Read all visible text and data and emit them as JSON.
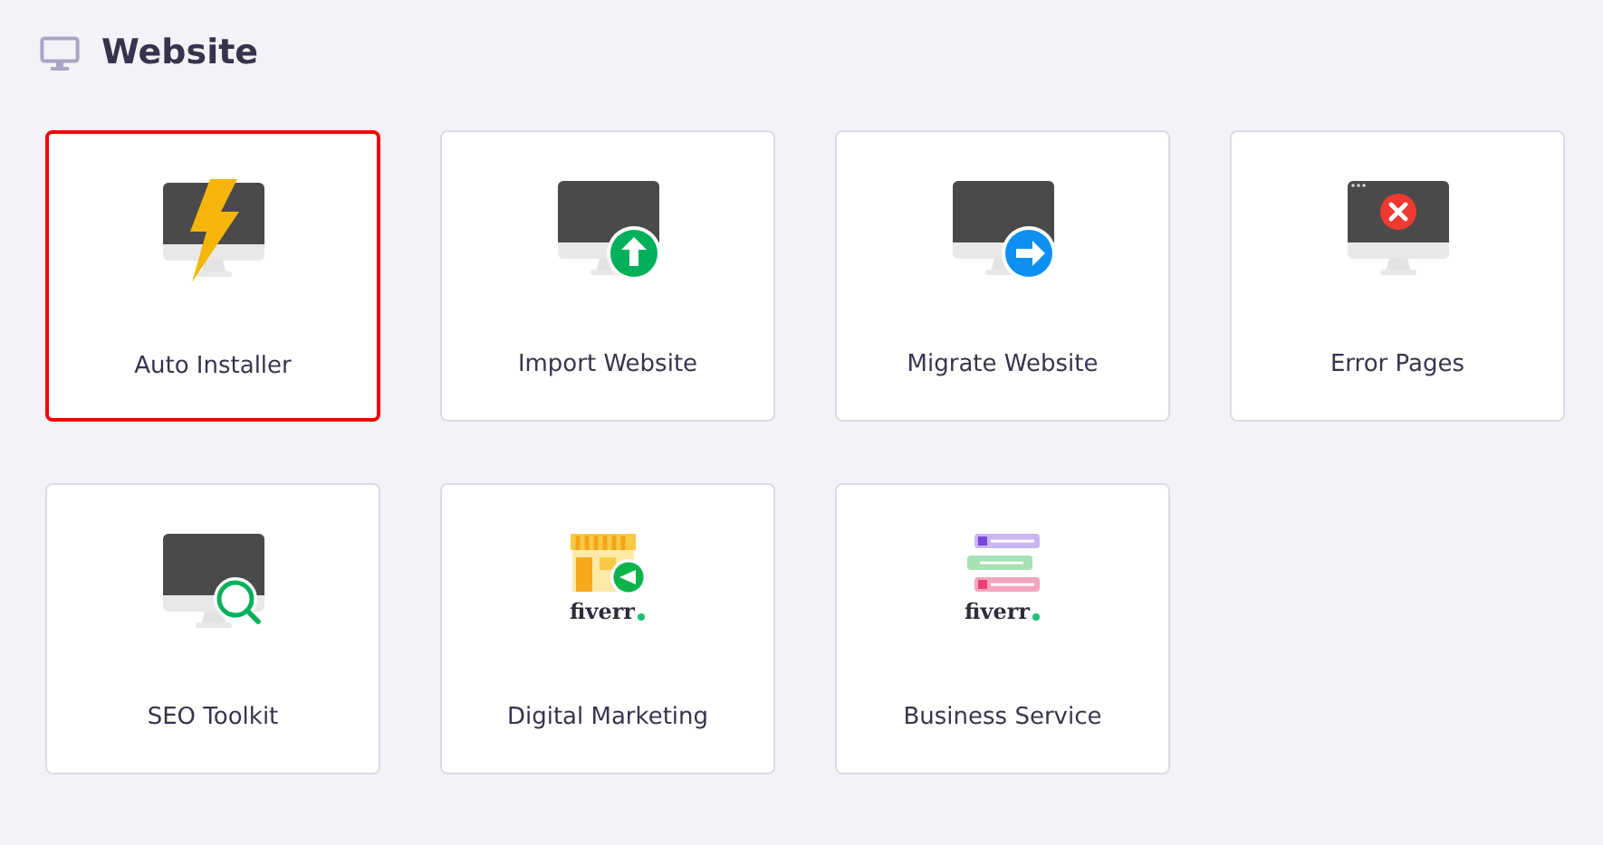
{
  "section": {
    "title": "Website"
  },
  "tiles": [
    {
      "label": "Auto Installer",
      "kind": "installer",
      "selected": true
    },
    {
      "label": "Import Website",
      "kind": "import",
      "selected": false
    },
    {
      "label": "Migrate Website",
      "kind": "migrate",
      "selected": false
    },
    {
      "label": "Error Pages",
      "kind": "error",
      "selected": false
    },
    {
      "label": "SEO Toolkit",
      "kind": "seo",
      "selected": false
    },
    {
      "label": "Digital Marketing",
      "kind": "marketing",
      "logo": "fiverr",
      "selected": false
    },
    {
      "label": "Business Service",
      "kind": "business",
      "logo": "fiverr",
      "selected": false
    }
  ]
}
